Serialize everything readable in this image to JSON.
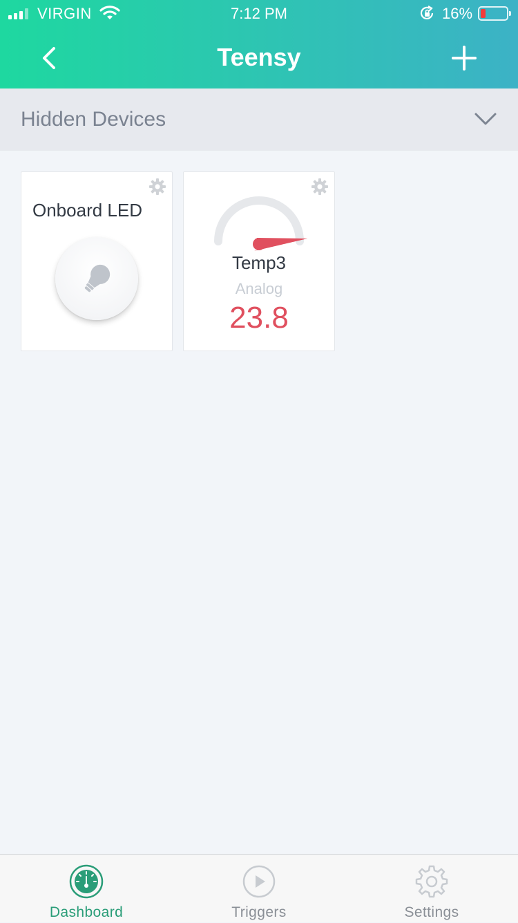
{
  "status_bar": {
    "carrier": "VIRGIN",
    "time": "7:12 PM",
    "battery_percent": "16%",
    "battery_level": 0.16,
    "signal_bars": 3
  },
  "nav": {
    "title": "Teensy",
    "back_icon": "chevron-left-icon",
    "add_icon": "plus-icon"
  },
  "hidden_devices": {
    "label": "Hidden Devices",
    "icon": "chevron-down-icon"
  },
  "devices": [
    {
      "name": "Onboard LED",
      "icon": "lightbulb-icon",
      "settings_icon": "gear-icon"
    },
    {
      "name": "Temp3",
      "type": "Analog",
      "value": "23.8",
      "icon": "gauge-icon",
      "settings_icon": "gear-icon"
    }
  ],
  "tabs": [
    {
      "label": "Dashboard",
      "icon": "dashboard-gauge-icon",
      "active": true
    },
    {
      "label": "Triggers",
      "icon": "play-icon",
      "active": false
    },
    {
      "label": "Settings",
      "icon": "gear-icon",
      "active": false
    }
  ],
  "colors": {
    "header_gradient_start": "#1ed8a0",
    "header_gradient_end": "#3cb2c6",
    "accent": "#2a9d78",
    "value_red": "#e0505f",
    "battery_low": "#f23b3b"
  }
}
